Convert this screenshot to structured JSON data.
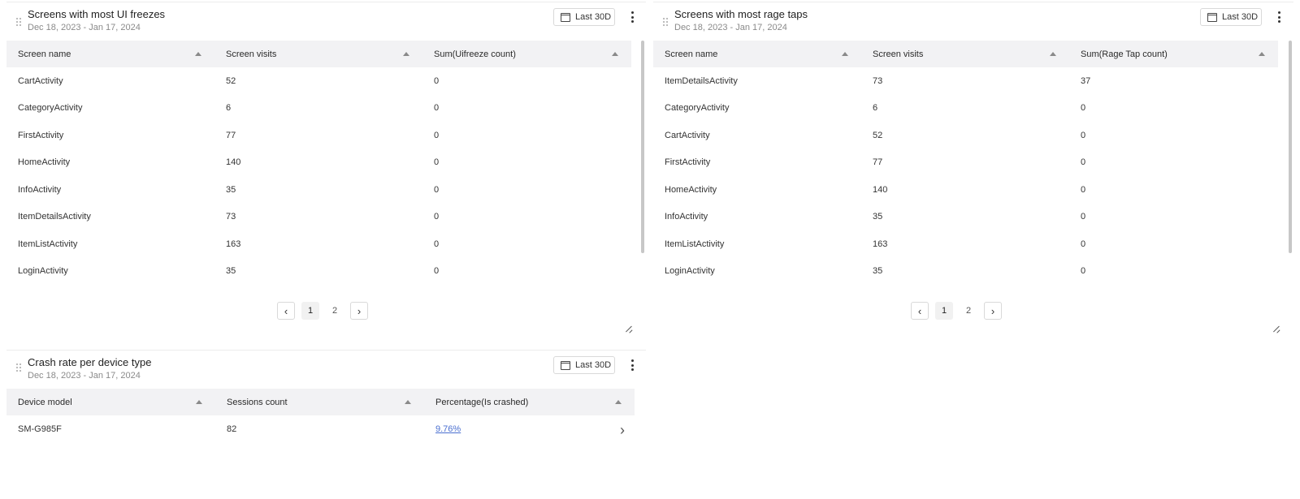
{
  "freeze": {
    "title": "Screens with most UI freezes",
    "date_range": "Dec 18, 2023 - Jan 17, 2024",
    "range_button": "Last 30D",
    "columns": [
      "Screen name",
      "Screen visits",
      "Sum(Uifreeze count)"
    ],
    "rows": [
      [
        "CartActivity",
        "52",
        "0"
      ],
      [
        "CategoryActivity",
        "6",
        "0"
      ],
      [
        "FirstActivity",
        "77",
        "0"
      ],
      [
        "HomeActivity",
        "140",
        "0"
      ],
      [
        "InfoActivity",
        "35",
        "0"
      ],
      [
        "ItemDetailsActivity",
        "73",
        "0"
      ],
      [
        "ItemListActivity",
        "163",
        "0"
      ],
      [
        "LoginActivity",
        "35",
        "0"
      ]
    ],
    "pages": [
      "1",
      "2"
    ]
  },
  "rage": {
    "title": "Screens with most rage taps",
    "date_range": "Dec 18, 2023 - Jan 17, 2024",
    "range_button": "Last 30D",
    "columns": [
      "Screen name",
      "Screen visits",
      "Sum(Rage Tap count)"
    ],
    "rows": [
      [
        "ItemDetailsActivity",
        "73",
        "37"
      ],
      [
        "CategoryActivity",
        "6",
        "0"
      ],
      [
        "CartActivity",
        "52",
        "0"
      ],
      [
        "FirstActivity",
        "77",
        "0"
      ],
      [
        "HomeActivity",
        "140",
        "0"
      ],
      [
        "InfoActivity",
        "35",
        "0"
      ],
      [
        "ItemListActivity",
        "163",
        "0"
      ],
      [
        "LoginActivity",
        "35",
        "0"
      ]
    ],
    "pages": [
      "1",
      "2"
    ]
  },
  "crash": {
    "title": "Crash rate per device type",
    "date_range": "Dec 18, 2023 - Jan 17, 2024",
    "range_button": "Last 30D",
    "columns": [
      "Device model",
      "Sessions count",
      "Percentage(Is crashed)"
    ],
    "rows": [
      [
        "SM-G985F",
        "82",
        "9.76%"
      ]
    ]
  },
  "icons": {
    "calendar": "calendar-icon",
    "menu": "more-vertical-icon",
    "drag": "drag-handle-icon",
    "sort": "sort-ascending-icon",
    "prev": "chevron-left-icon",
    "next": "chevron-right-icon",
    "resize": "resize-handle-icon"
  },
  "colors": {
    "link": "#4a6fd0",
    "header_bg": "#f2f2f4"
  }
}
